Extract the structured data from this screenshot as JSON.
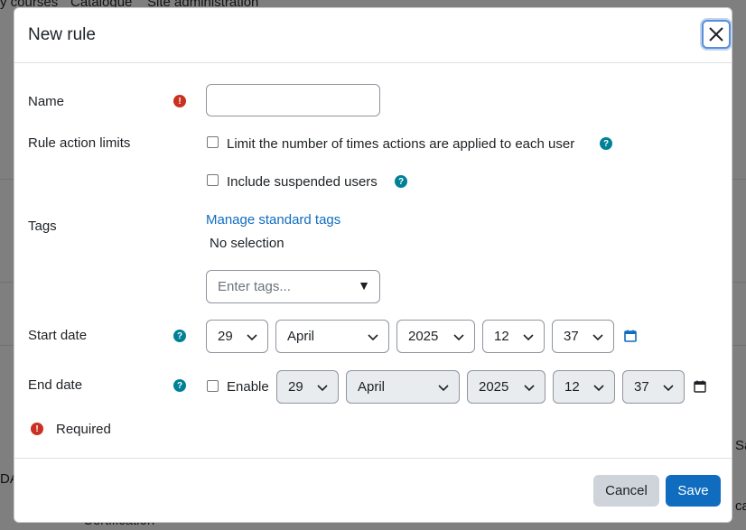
{
  "background": {
    "nav": [
      "y courses",
      "Catalogue",
      "Site administration"
    ],
    "left_text": "DA",
    "bottom_text": "Certification",
    "right_text_1": "Sa",
    "right_text_2": "ca"
  },
  "modal": {
    "title": "New rule",
    "close_label": "×",
    "fields": {
      "name": {
        "label": "Name",
        "value": ""
      },
      "rule_action_limits": {
        "label": "Rule action limits",
        "option1": "Limit the number of times actions are applied to each user",
        "option2": "Include suspended users"
      },
      "tags": {
        "label": "Tags",
        "manage_link": "Manage standard tags",
        "selection": "No selection",
        "placeholder": "Enter tags...",
        "arrow": "▼"
      },
      "start_date": {
        "label": "Start date",
        "day": "29",
        "month": "April",
        "year": "2025",
        "hour": "12",
        "minute": "37"
      },
      "end_date": {
        "label": "End date",
        "enable_label": "Enable",
        "day": "29",
        "month": "April",
        "year": "2025",
        "hour": "12",
        "minute": "37"
      }
    },
    "required_note": "Required",
    "required_icon": "!",
    "help_icon": "?",
    "footer": {
      "cancel": "Cancel",
      "save": "Save"
    }
  },
  "colors": {
    "primary": "#0f6cbf",
    "required": "#ca3120",
    "help": "#008196",
    "secondary_button": "#ced4da"
  }
}
